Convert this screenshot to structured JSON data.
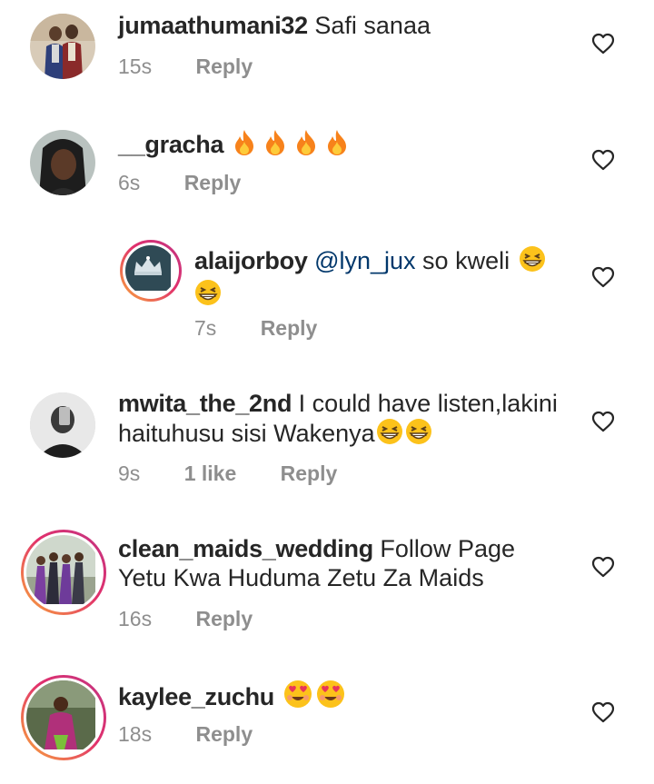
{
  "comments": [
    {
      "username": "jumaathumani32",
      "text": "Safi sanaa",
      "time": "15s",
      "reply_label": "Reply",
      "avatar": "two-men-photo"
    },
    {
      "username": "__gracha",
      "text": "",
      "emojis": [
        "fire",
        "fire",
        "fire",
        "fire"
      ],
      "time": "6s",
      "reply_label": "Reply",
      "avatar": "woman-braids-photo"
    },
    {
      "username": "alaijorboy",
      "mention": "@lyn_jux",
      "text": "so kweli",
      "emojis": [
        "grinning-squinting-face",
        "grinning-squinting-face"
      ],
      "time": "7s",
      "reply_label": "Reply",
      "avatar": "crown-photo",
      "is_reply": true
    },
    {
      "username": "mwita_the_2nd",
      "text": "I could have listen,lakini haituhusu sisi Wakenya",
      "emojis": [
        "grinning-squinting-face",
        "grinning-squinting-face"
      ],
      "time": "9s",
      "likes": "1 like",
      "reply_label": "Reply",
      "avatar": "man-bw-photo"
    },
    {
      "username": "clean_maids_wedding",
      "text": "Follow Page Yetu Kwa Huduma Zetu Za Maids",
      "time": "16s",
      "reply_label": "Reply",
      "avatar": "wedding-group-photo"
    },
    {
      "username": "kaylee_zuchu",
      "text": "",
      "emojis": [
        "heart-eyes-face",
        "heart-eyes-face"
      ],
      "time": "18s",
      "reply_label": "Reply",
      "avatar": "woman-purple-photo"
    }
  ],
  "colors": {
    "text": "#262626",
    "secondary": "#8e8e8e",
    "mention": "#00376b",
    "story_ring_start": "#f9a93a",
    "story_ring_end": "#c13584"
  },
  "icons": {
    "like": "heart-outline-icon"
  }
}
